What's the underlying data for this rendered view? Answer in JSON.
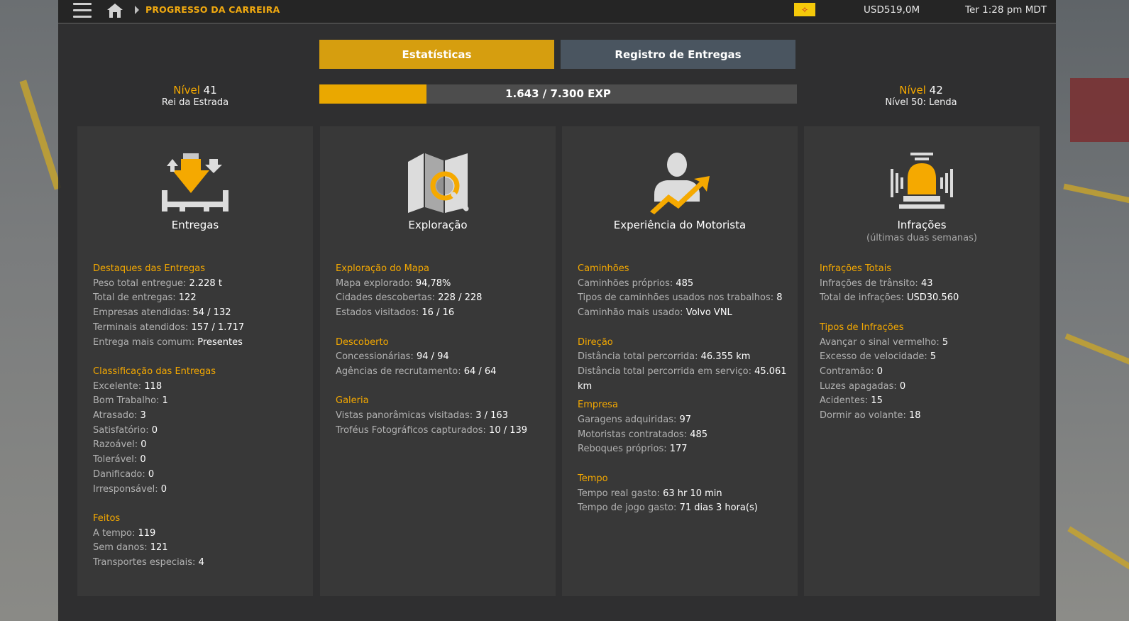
{
  "topbar": {
    "breadcrumb": "PROGRESSO DA CARREIRA",
    "money": "USD519,0M",
    "clock": "Ter 1:28 pm MDT",
    "flag_icon": "new-mexico-flag",
    "colors": {
      "accent": "#f0a910"
    }
  },
  "tabs": [
    {
      "label": "Estatísticas",
      "active": true
    },
    {
      "label": "Registro de Entregas",
      "active": false
    }
  ],
  "level": {
    "label": "Nível",
    "current": "41",
    "current_title": "Rei da Estrada",
    "next": "42",
    "next_title": "Nível 50: Lenda",
    "xp_text": "1.643 / 7.300 EXP",
    "xp_fraction": 0.225
  },
  "cards": [
    {
      "title": "Entregas",
      "icon": "delivery-icon",
      "sections": [
        {
          "title": "Destaques das Entregas",
          "rows": [
            {
              "label": "Peso total entregue: ",
              "value": "2.228 t"
            },
            {
              "label": "Total de entregas: ",
              "value": "122"
            },
            {
              "label": "Empresas atendidas: ",
              "value": "54 / 132"
            },
            {
              "label": "Terminais atendidos: ",
              "value": "157 / 1.717"
            },
            {
              "label": "Entrega mais comum: ",
              "value": "Presentes"
            }
          ]
        },
        {
          "title": "Classificação das Entregas",
          "rows": [
            {
              "label": "Excelente: ",
              "value": "118"
            },
            {
              "label": "Bom Trabalho: ",
              "value": "1"
            },
            {
              "label": "Atrasado: ",
              "value": "3"
            },
            {
              "label": "Satisfatório: ",
              "value": "0"
            },
            {
              "label": "Razoável: ",
              "value": "0"
            },
            {
              "label": "Tolerável: ",
              "value": "0"
            },
            {
              "label": "Danificado: ",
              "value": "0"
            },
            {
              "label": "Irresponsável: ",
              "value": "0"
            }
          ]
        },
        {
          "title": "Feitos",
          "rows": [
            {
              "label": "A tempo: ",
              "value": "119"
            },
            {
              "label": "Sem danos: ",
              "value": "121"
            },
            {
              "label": "Transportes especiais: ",
              "value": "4"
            }
          ]
        }
      ]
    },
    {
      "title": "Exploração",
      "icon": "map-search-icon",
      "sections": [
        {
          "title": "Exploração do Mapa",
          "rows": [
            {
              "label": "Mapa explorado: ",
              "value": "94,78%"
            },
            {
              "label": "Cidades descobertas: ",
              "value": "228 / 228"
            },
            {
              "label": "Estados visitados: ",
              "value": "16 / 16"
            }
          ]
        },
        {
          "title": "Descoberto",
          "rows": [
            {
              "label": "Concessionárias: ",
              "value": "94 / 94"
            },
            {
              "label": "Agências de recrutamento: ",
              "value": "64 / 64"
            }
          ]
        },
        {
          "title": "Galeria",
          "rows": [
            {
              "label": "Vistas panorâmicas visitadas: ",
              "value": "3 / 163"
            },
            {
              "label": "Troféus Fotográficos capturados: ",
              "value": "10 / 139"
            }
          ]
        }
      ]
    },
    {
      "title": "Experiência do Motorista",
      "icon": "driver-growth-icon",
      "sections": [
        {
          "title": "Caminhões",
          "rows": [
            {
              "label": "Caminhões próprios: ",
              "value": "485"
            },
            {
              "label": "Tipos de caminhões usados nos trabalhos: ",
              "value": "8"
            },
            {
              "label": "Caminhão mais usado: ",
              "value": "Volvo VNL"
            }
          ]
        },
        {
          "title": "Direção",
          "rows": [
            {
              "label": "Distância total percorrida: ",
              "value": "46.355 km"
            },
            {
              "label": "Distância total percorrida em serviço: ",
              "value": "45.061 km"
            }
          ]
        },
        {
          "title": "Empresa",
          "tight": true,
          "rows": [
            {
              "label": "Garagens adquiridas: ",
              "value": "97"
            },
            {
              "label": "Motoristas contratados: ",
              "value": "485"
            },
            {
              "label": "Reboques próprios: ",
              "value": "177"
            }
          ]
        },
        {
          "title": "Tempo",
          "rows": [
            {
              "label": "Tempo real gasto: ",
              "value": "63 hr 10 min"
            },
            {
              "label": "Tempo de jogo gasto: ",
              "value": "71 dias 3 hora(s)"
            }
          ]
        }
      ]
    },
    {
      "title": "Infrações",
      "subtitle": "(últimas duas semanas)",
      "icon": "alarm-siren-icon",
      "sections": [
        {
          "title": "Infrações Totais",
          "rows": [
            {
              "label": "Infrações de trânsito: ",
              "value": "43"
            },
            {
              "label": "Total de infrações: ",
              "value": "USD30.560"
            }
          ]
        },
        {
          "title": "Tipos de Infrações",
          "rows": [
            {
              "label": "Avançar o sinal vermelho: ",
              "value": "5"
            },
            {
              "label": "Excesso de velocidade: ",
              "value": "5"
            },
            {
              "label": "Contramão: ",
              "value": "0"
            },
            {
              "label": "Luzes apagadas: ",
              "value": "0"
            },
            {
              "label": "Acidentes: ",
              "value": "15"
            },
            {
              "label": "Dormir ao volante: ",
              "value": "18"
            }
          ]
        }
      ]
    }
  ]
}
